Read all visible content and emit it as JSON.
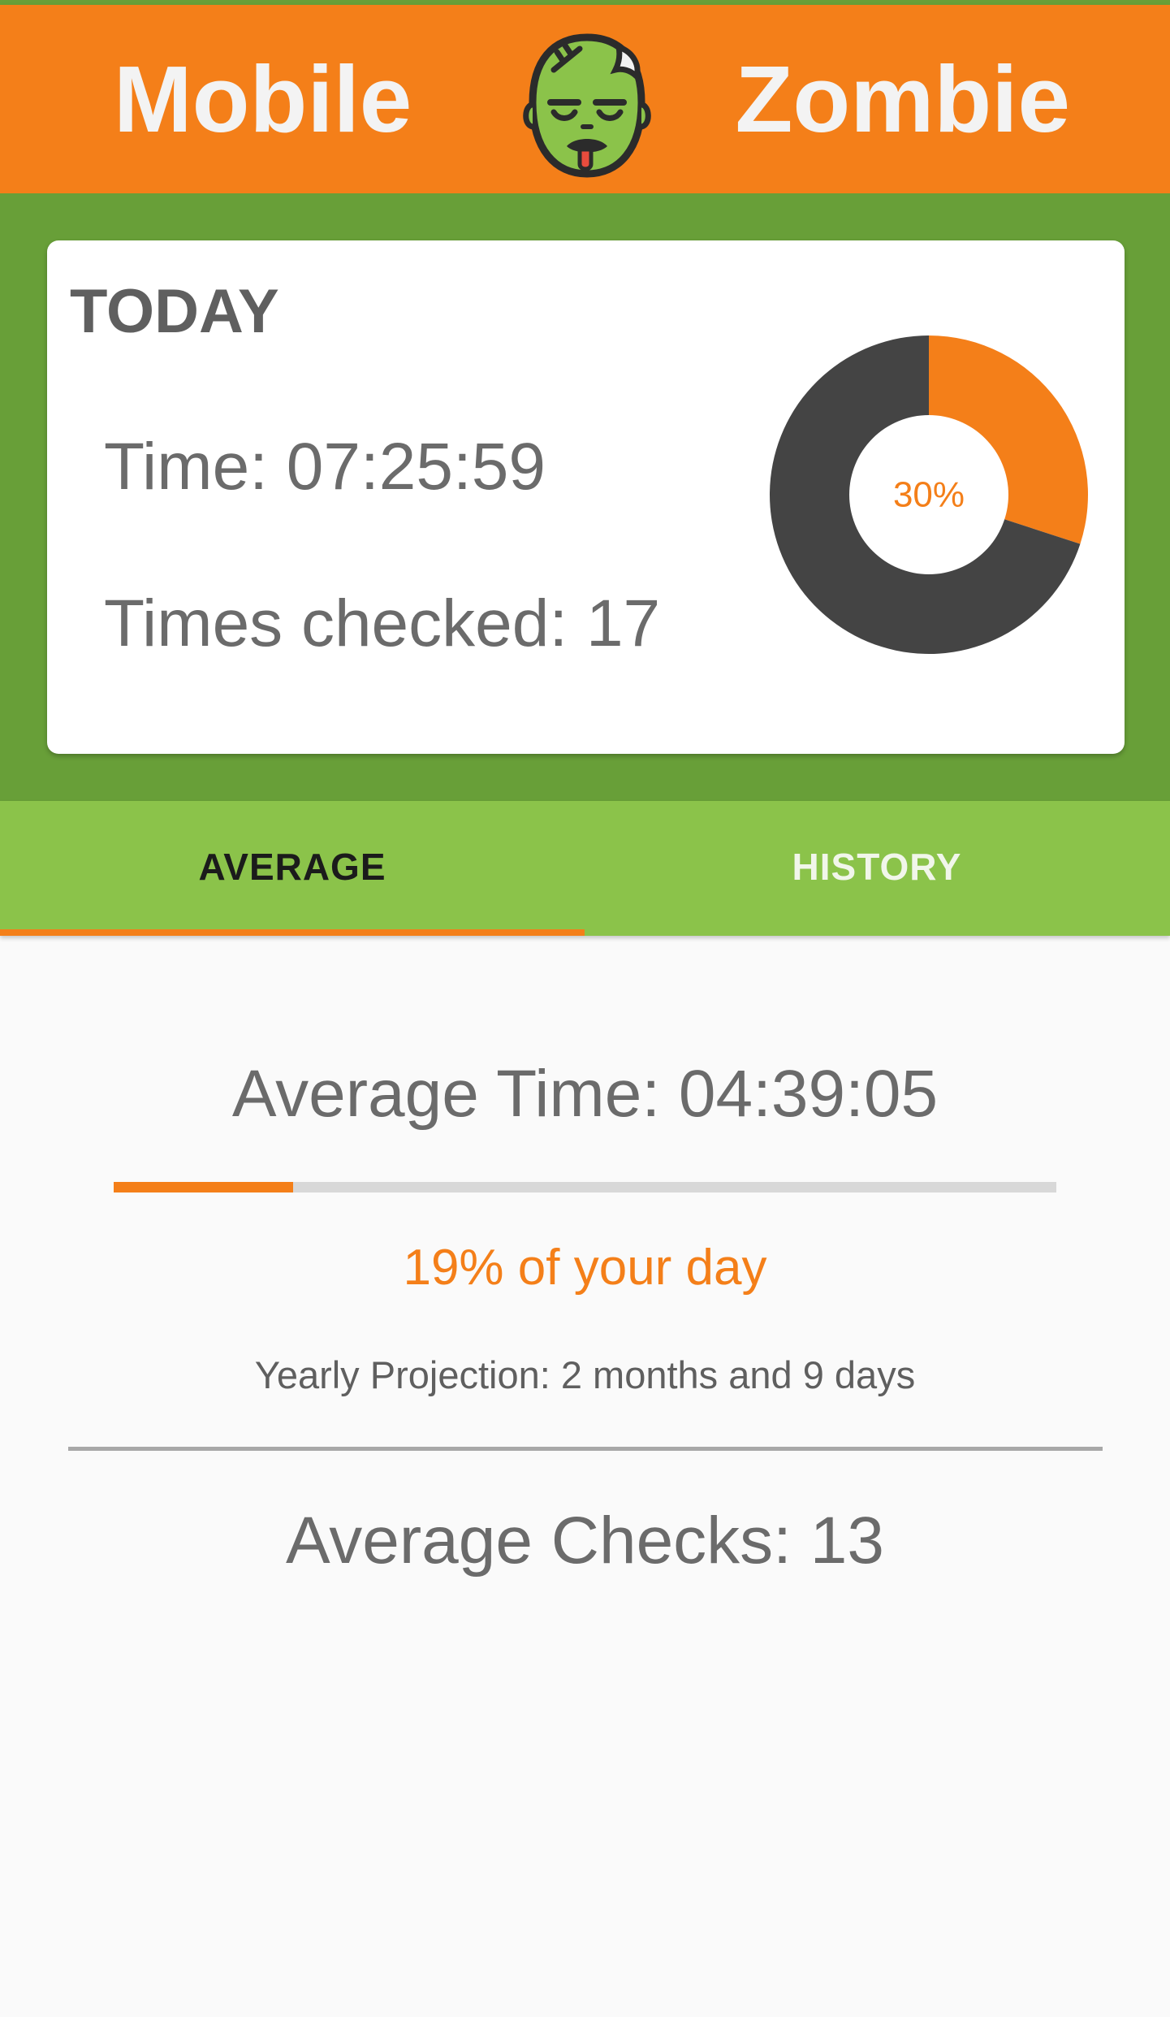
{
  "app": {
    "title_left": "Mobile",
    "title_right": "Zombie",
    "logo_icon": "zombie-face-icon"
  },
  "colors": {
    "accent": "#f47f19",
    "primary_dark": "#689f38",
    "primary": "#8bc34a",
    "donut_remaining": "#444444"
  },
  "today": {
    "title": "TODAY",
    "time_text": "Time: 07:25:59",
    "checks_text": "Times checked: 17",
    "chart_label": "30%"
  },
  "tabs": [
    {
      "label": "AVERAGE",
      "selected": true
    },
    {
      "label": "HISTORY",
      "selected": false
    }
  ],
  "average": {
    "time_text": "Average Time: 04:39:05",
    "day_fraction": 0.19,
    "percent_text": "19% of your day",
    "yearly_text": "Yearly Projection: 2 months and 9 days",
    "checks_text": "Average Checks: 13"
  },
  "chart_data": {
    "type": "pie",
    "categories": [
      "",
      ""
    ],
    "values": [
      30,
      70
    ],
    "title": "",
    "center_label": "30%",
    "donut": true
  }
}
